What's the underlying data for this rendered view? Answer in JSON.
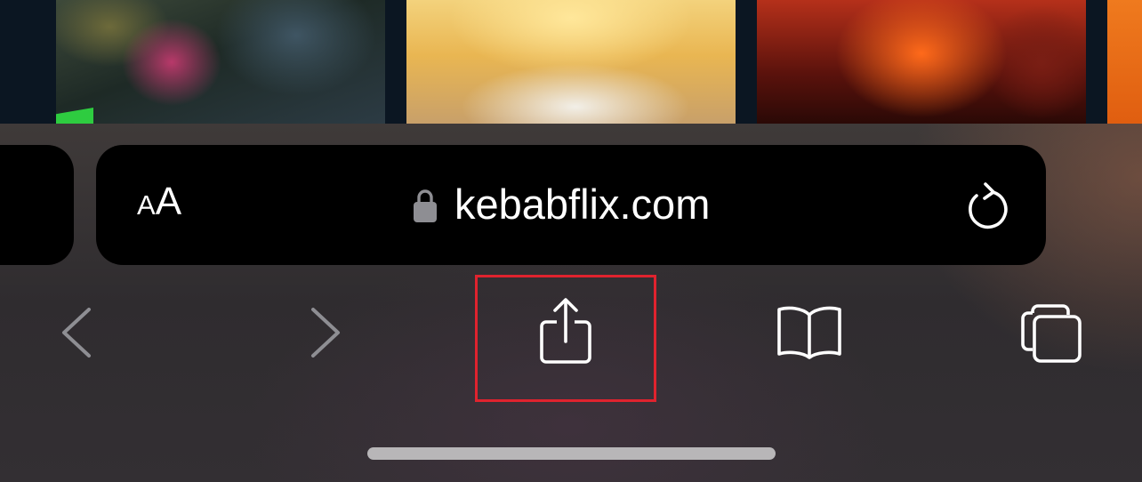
{
  "address_bar": {
    "text_size_small": "A",
    "text_size_large": "A",
    "url": "kebabflix.com",
    "lock_icon": "lock-icon",
    "reload_icon": "reload-icon"
  },
  "toolbar": {
    "back_icon": "chevron-left-icon",
    "forward_icon": "chevron-right-icon",
    "share_icon": "share-icon",
    "bookmarks_icon": "book-icon",
    "tabs_icon": "tabs-icon"
  },
  "colors": {
    "highlight": "#e0232e",
    "bar_background": "#000000",
    "icon_active": "#ffffff",
    "icon_disabled": "#8e8e93"
  }
}
